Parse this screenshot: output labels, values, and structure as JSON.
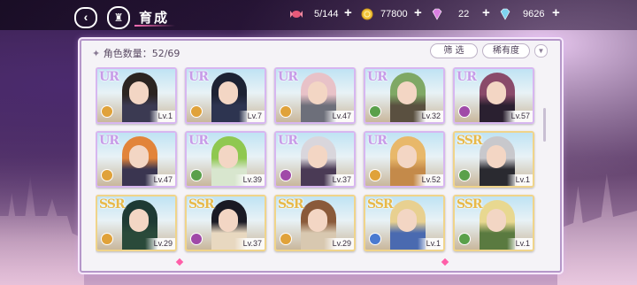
{
  "header": {
    "title": "育成",
    "back_icon": "back-arrow-icon",
    "home_icon": "castle-home-icon"
  },
  "resources": [
    {
      "name": "candy",
      "icon": "candy-icon",
      "value": "5/144",
      "color": "#e85a7a"
    },
    {
      "name": "coin",
      "icon": "gold-coin-icon",
      "value": "77800",
      "color": "#f2c43a"
    },
    {
      "name": "gem-pink",
      "icon": "pink-diamond-icon",
      "value": "22",
      "color": "#d97fe0"
    },
    {
      "name": "gem-blue",
      "icon": "blue-diamond-icon",
      "value": "9626",
      "color": "#7fd4f0"
    }
  ],
  "panel": {
    "count_label": "角色数量：52/69",
    "filter_label": "筛 选",
    "sort_label": "稀有度"
  },
  "characters": [
    {
      "rarity": "UR",
      "level": "Lv.1",
      "element_color": "#e0a23a",
      "hair": "#2b2420",
      "cloth": "#3b3a52"
    },
    {
      "rarity": "UR",
      "level": "Lv.7",
      "element_color": "#e0a23a",
      "hair": "#1d2233",
      "cloth": "#2d3450"
    },
    {
      "rarity": "UR",
      "level": "Lv.47",
      "element_color": "#e0a23a",
      "hair": "#e8c2c8",
      "cloth": "#6d6f7a"
    },
    {
      "rarity": "UR",
      "level": "Lv.32",
      "element_color": "#5aa04a",
      "hair": "#7fa865",
      "cloth": "#5a5040"
    },
    {
      "rarity": "UR",
      "level": "Lv.57",
      "element_color": "#a04aa8",
      "hair": "#8a4a6a",
      "cloth": "#2a2030"
    },
    {
      "rarity": "UR",
      "level": "Lv.47",
      "element_color": "#e0a23a",
      "hair": "#e2843a",
      "cloth": "#3a3550"
    },
    {
      "rarity": "UR",
      "level": "Lv.39",
      "element_color": "#5aa04a",
      "hair": "#8fc850",
      "cloth": "#d8e6ce"
    },
    {
      "rarity": "UR",
      "level": "Lv.37",
      "element_color": "#a04aa8",
      "hair": "#d9d6dc",
      "cloth": "#4a3a55"
    },
    {
      "rarity": "UR",
      "level": "Lv.52",
      "element_color": "#e0a23a",
      "hair": "#e8b86a",
      "cloth": "#c48a4a"
    },
    {
      "rarity": "SSR",
      "level": "Lv.1",
      "element_color": "#5aa04a",
      "hair": "#c8c8cc",
      "cloth": "#2a2a30"
    },
    {
      "rarity": "SSR",
      "level": "Lv.29",
      "element_color": "#e0a23a",
      "hair": "#1e3a34",
      "cloth": "#2a4a3a"
    },
    {
      "rarity": "SSR",
      "level": "Lv.37",
      "element_color": "#a04aa8",
      "hair": "#1a1a24",
      "cloth": "#e8d8c0"
    },
    {
      "rarity": "SSR",
      "level": "Lv.29",
      "element_color": "#e0a23a",
      "hair": "#8a5a3a",
      "cloth": "#d8c8b0"
    },
    {
      "rarity": "SSR",
      "level": "Lv.1",
      "element_color": "#4a7ad0",
      "hair": "#e8d090",
      "cloth": "#4a6ab0"
    },
    {
      "rarity": "SSR",
      "level": "Lv.1",
      "element_color": "#5aa04a",
      "hair": "#e8d890",
      "cloth": "#5a7a40"
    }
  ]
}
